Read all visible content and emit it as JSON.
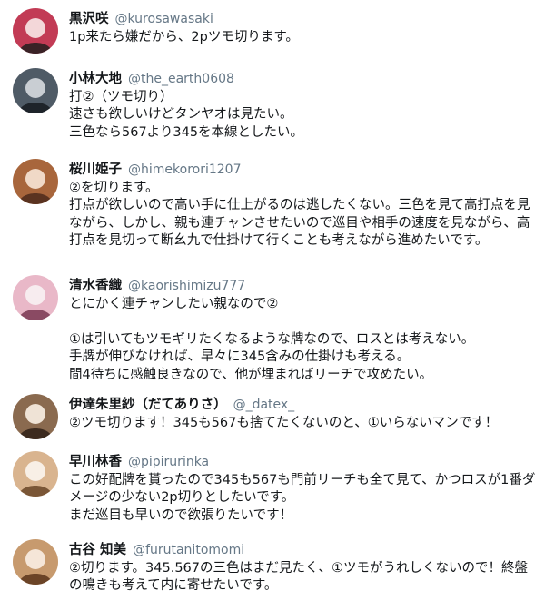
{
  "tweets": [
    {
      "name": "黒沢咲",
      "handle": "@kurosawasaki",
      "text": "1p来たら嫌だから、2pツモ切ります。",
      "avatar_colors": [
        "#c23b55",
        "#f3d7d9",
        "#3a2226"
      ]
    },
    {
      "name": "小林大地",
      "handle": "@the_earth0608",
      "text": "打②（ツモ切り）\n速さも欲しいけどタンヤオは見たい。\n三色なら567より345を本線としたい。",
      "avatar_colors": [
        "#4f5b66",
        "#c9ced3",
        "#1e242a"
      ]
    },
    {
      "name": "桜川姫子",
      "handle": "@himekorori1207",
      "text": "②を切ります。\n打点が欲しいので高い手に仕上がるのは逃したくない。三色を見て高打点を見ながら、しかし、親も連チャンさせたいので巡目や相手の速度を見ながら、高打点を見切って断幺九で仕掛けて行くことも考えながら進めたいです。",
      "avatar_colors": [
        "#a8663c",
        "#f0d9c7",
        "#5a3320"
      ]
    },
    {
      "name": "清水香織",
      "handle": "@kaorishimizu777",
      "text": "とにかく連チャンしたい親なので②\n\n①は引いてもツモギリたくなるような牌なので、ロスとは考えない。\n手牌が伸びなければ、早々に345含みの仕掛けも考える。\n間4待ちに感触良きなので、他が埋まればリーチで攻めたい。",
      "avatar_colors": [
        "#e9b8c8",
        "#f7ecef",
        "#8a4a63"
      ]
    },
    {
      "name": "伊達朱里紗（だてありさ）",
      "handle": "@_datex_",
      "text": "②ツモ切ります！345も567も捨てたくないのと、①いらないマンです！",
      "avatar_colors": [
        "#8a6a4f",
        "#efe3d6",
        "#3d2b1f"
      ]
    },
    {
      "name": "早川林香",
      "handle": "@pipirurinka",
      "text": "この好配牌を貰ったので345も567も門前リーチも全て見て、かつロスが1番ダメージの少ない2p切りとしたいです。\nまだ巡目も早いので欲張りたいです！",
      "avatar_colors": [
        "#d9b48f",
        "#f8efe6",
        "#7a5636"
      ]
    },
    {
      "name": "古谷 知美",
      "handle": "@furutanitomomi",
      "text": "②切ります。345.567の三色はまだ見たく、①ツモがうれしくないので！終盤の鳴きも考えて内に寄せたいです。",
      "avatar_colors": [
        "#c79a6e",
        "#f5e6d8",
        "#6b4427"
      ]
    }
  ]
}
